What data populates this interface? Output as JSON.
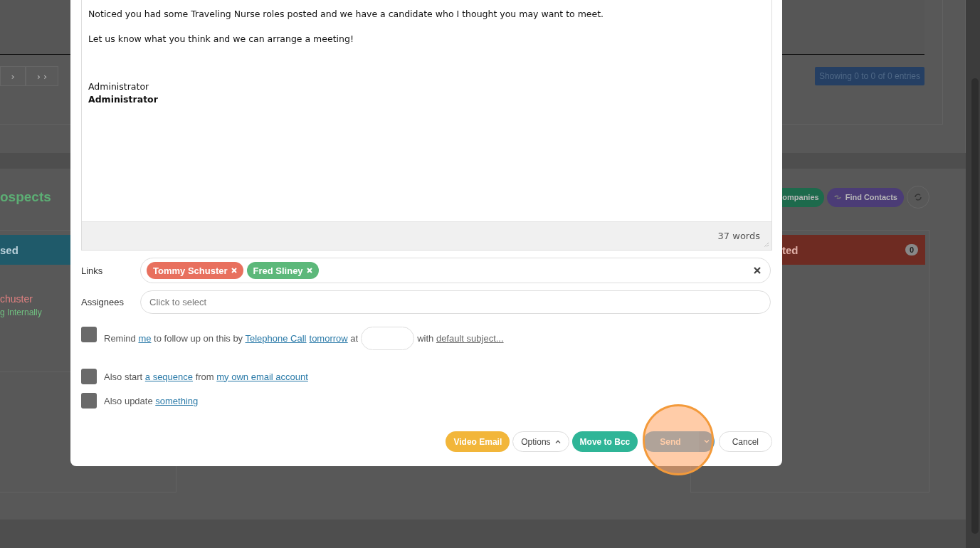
{
  "background": {
    "pagination_buttons": [
      "›",
      "› ›"
    ],
    "entries_info": "Showing 0 to 0 of 0 entries",
    "section_title": "ospects",
    "action_buttons": [
      {
        "label": "ompanies",
        "color": "#1d6a4c"
      },
      {
        "label": "Find Contacts",
        "color": "#4b3c76"
      }
    ],
    "columns": [
      {
        "title": "sed",
        "color": "#1f5a6a",
        "cards": [
          {
            "name": "chuster",
            "status": "g Internally"
          }
        ]
      },
      {
        "title": "ted",
        "color": "#6e2b22",
        "count": "0"
      }
    ]
  },
  "modal": {
    "paragraphs": [
      {
        "text": "Noticed you had some Traveling Nurse roles posted and we have a candidate who I thought you may want to meet.",
        "bold": false,
        "kind": "body"
      },
      {
        "text": "Let us know what you think and we can arrange a meeting!",
        "bold": false,
        "kind": "body"
      },
      {
        "text": "Administrator",
        "bold": false,
        "kind": "signature"
      },
      {
        "text": "Administrator",
        "bold": true,
        "kind": "signature"
      }
    ],
    "word_count": "37 words",
    "links": {
      "label": "Links",
      "tags": [
        {
          "name": "Tommy Schuster",
          "color": "#e8705e"
        },
        {
          "name": "Fred Sliney",
          "color": "#5cb87a"
        }
      ]
    },
    "assignees": {
      "label": "Assignees",
      "placeholder": "Click to select"
    },
    "options": [
      {
        "checked": false,
        "parts": [
          {
            "kind": "text",
            "runs": [
              {
                "text": "Remind ",
                "kind": "text"
              },
              {
                "text": "me",
                "kind": "link"
              },
              {
                "text": " to follow up on this by ",
                "kind": "text"
              },
              {
                "text": "Telephone Call",
                "kind": "link"
              },
              {
                "text": "tomorrow",
                "kind": "link"
              },
              {
                "text": " at",
                "kind": "text"
              }
            ]
          },
          {
            "kind": "field"
          },
          {
            "kind": "text",
            "runs": [
              {
                "text": "with ",
                "kind": "text"
              },
              {
                "text": "default subject...",
                "kind": "grey_link"
              }
            ]
          }
        ]
      },
      {
        "checked": false,
        "parts": [
          {
            "kind": "text",
            "runs": [
              {
                "text": "Also start ",
                "kind": "text"
              },
              {
                "text": "a sequence",
                "kind": "link"
              },
              {
                "text": " from ",
                "kind": "text"
              },
              {
                "text": "my own email account",
                "kind": "link"
              }
            ]
          }
        ]
      },
      {
        "checked": false,
        "parts": [
          {
            "kind": "text",
            "runs": [
              {
                "text": "Also update ",
                "kind": "text"
              },
              {
                "text": "something",
                "kind": "link"
              }
            ]
          }
        ]
      }
    ],
    "buttons": [
      {
        "label": "Video Email",
        "kind": "video"
      },
      {
        "label": "Options",
        "kind": "dropdown"
      },
      {
        "label": "Move to Bcc",
        "kind": "bcc"
      },
      {
        "label": "Send",
        "kind": "split"
      },
      {
        "label": "Cancel",
        "kind": "plain"
      }
    ]
  }
}
